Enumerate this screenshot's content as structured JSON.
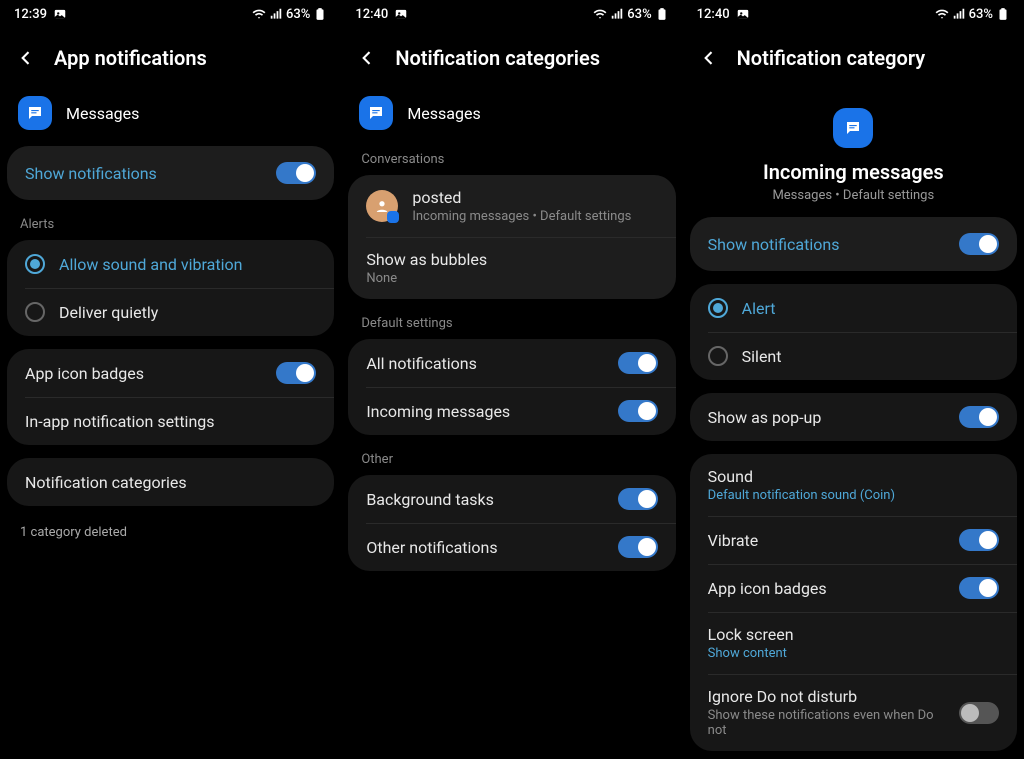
{
  "status": {
    "battery": "63%",
    "photo_icon": true
  },
  "screen1": {
    "time": "12:39",
    "title": "App notifications",
    "app_name": "Messages",
    "show_notifications": "Show notifications",
    "alerts_label": "Alerts",
    "allow_sound": "Allow sound and vibration",
    "deliver_quietly": "Deliver quietly",
    "app_icon_badges": "App icon badges",
    "in_app_settings": "In-app notification settings",
    "notif_categories": "Notification categories",
    "footer": "1 category deleted"
  },
  "screen2": {
    "time": "12:40",
    "title": "Notification categories",
    "app_name": "Messages",
    "conversations_label": "Conversations",
    "posted": "posted",
    "posted_sub": "Incoming messages • Default settings",
    "bubbles": "Show as bubbles",
    "bubbles_sub": "None",
    "default_label": "Default settings",
    "all_notifications": "All notifications",
    "incoming": "Incoming messages",
    "other_label": "Other",
    "background": "Background tasks",
    "other_notifs": "Other notifications"
  },
  "screen3": {
    "time": "12:40",
    "title": "Notification category",
    "big_title": "Incoming messages",
    "sub": "Messages • Default settings",
    "show_notifications": "Show notifications",
    "alert": "Alert",
    "silent": "Silent",
    "popup": "Show as pop-up",
    "sound": "Sound",
    "sound_sub": "Default notification sound (Coin)",
    "vibrate": "Vibrate",
    "badges": "App icon badges",
    "lock": "Lock screen",
    "lock_sub": "Show content",
    "dnd": "Ignore Do not disturb",
    "dnd_sub": "Show these notifications even when Do not"
  }
}
